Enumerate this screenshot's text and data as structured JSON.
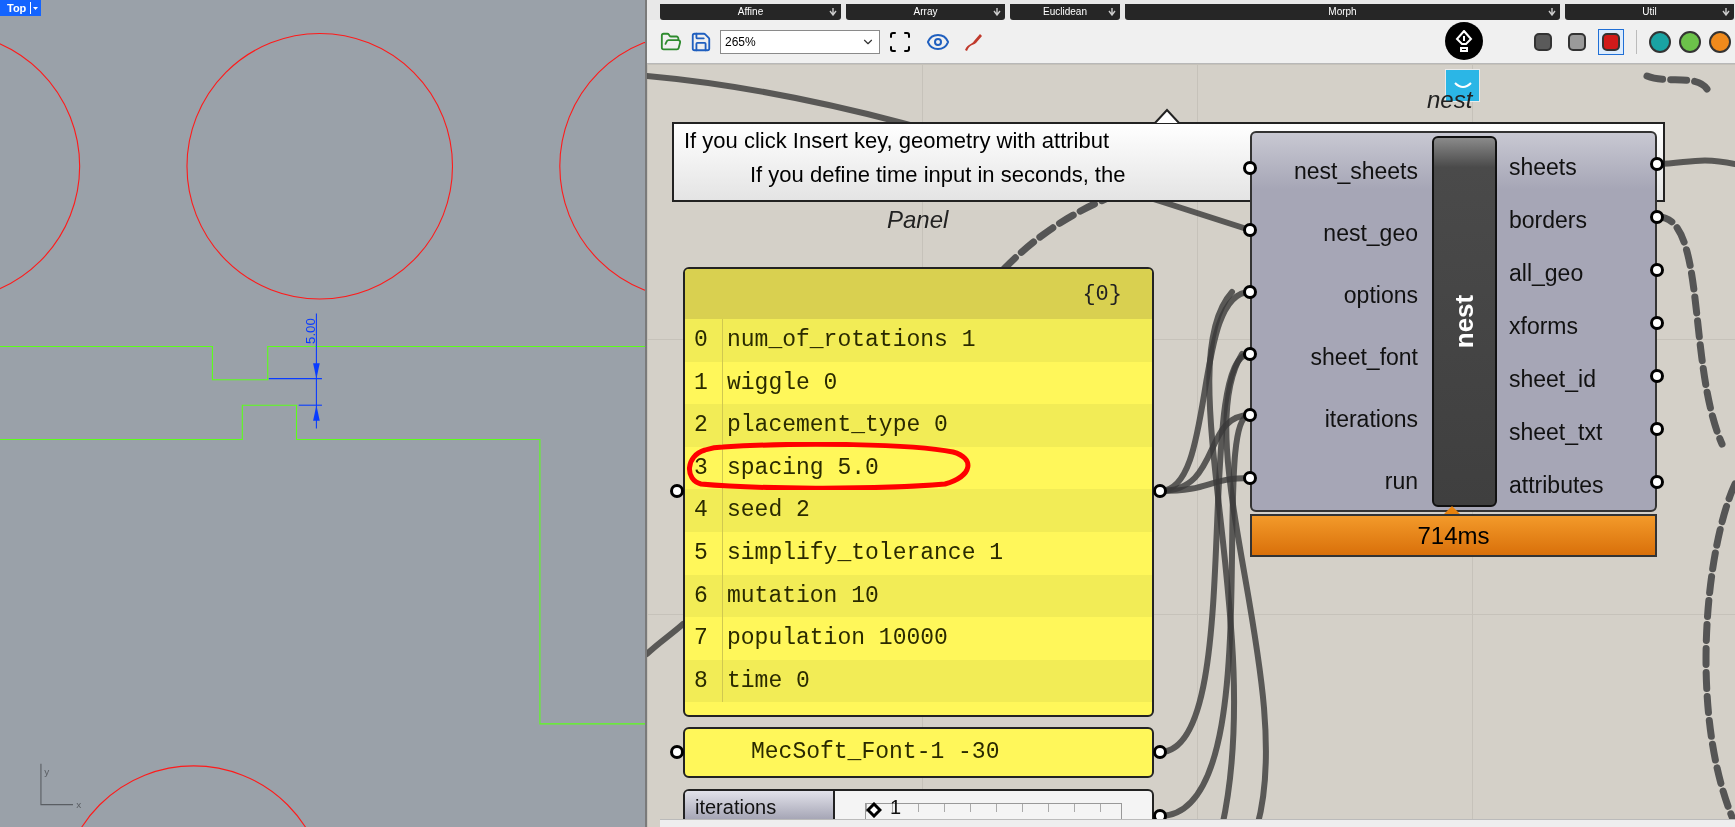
{
  "viewport": {
    "name": "Top",
    "dimension": "5.00",
    "axis_y": "y",
    "axis_x": "x"
  },
  "component_tabs": [
    {
      "label": "Affine"
    },
    {
      "label": "Array"
    },
    {
      "label": "Euclidean"
    },
    {
      "label": "Morph"
    },
    {
      "label": "Util"
    }
  ],
  "toolbar": {
    "zoom": "265%",
    "preview_buttons": [
      {
        "selected": false
      },
      {
        "selected": false
      },
      {
        "selected": true
      }
    ]
  },
  "canvas": {
    "tooltip": {
      "lines": [
        "If you click Insert key, geometry with attribut",
        "If you define time input in seconds, the"
      ]
    },
    "nest": {
      "label": "nest",
      "title": "nest",
      "inputs": [
        "nest_sheets",
        "nest_geo",
        "options",
        "sheet_font",
        "iterations",
        "run"
      ],
      "outputs": [
        "sheets",
        "borders",
        "all_geo",
        "xforms",
        "sheet_id",
        "sheet_txt",
        "attributes"
      ],
      "timing": "714ms"
    },
    "panel": {
      "label": "Panel",
      "path": "{0}",
      "rows": [
        {
          "index": "0",
          "text": "num_of_rotations 1"
        },
        {
          "index": "1",
          "text": "wiggle 0"
        },
        {
          "index": "2",
          "text": "placement_type 0"
        },
        {
          "index": "3",
          "text": "spacing 5.0"
        },
        {
          "index": "4",
          "text": "seed 2"
        },
        {
          "index": "5",
          "text": "simplify_tolerance 1"
        },
        {
          "index": "6",
          "text": "mutation 10"
        },
        {
          "index": "7",
          "text": "population 10000"
        },
        {
          "index": "8",
          "text": "time 0"
        }
      ]
    },
    "font_panel": {
      "text": "MecSoft_Font-1 -30"
    },
    "slider": {
      "label": "iterations",
      "value": "1",
      "level": 0.0
    }
  }
}
